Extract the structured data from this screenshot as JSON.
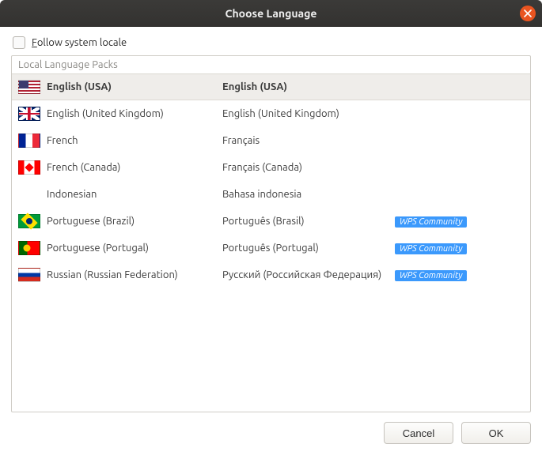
{
  "titlebar": {
    "title": "Choose Language"
  },
  "follow_checkbox": {
    "label": "Follow system locale",
    "checked": false
  },
  "list": {
    "header": "Local Language Packs",
    "items": [
      {
        "flag": "usa",
        "name": "English (USA)",
        "native": "English (USA)",
        "badge": "",
        "selected": true
      },
      {
        "flag": "uk",
        "name": "English (United Kingdom)",
        "native": "English (United Kingdom)",
        "badge": "",
        "selected": false
      },
      {
        "flag": "fr",
        "name": "French",
        "native": "Français",
        "badge": "",
        "selected": false
      },
      {
        "flag": "ca",
        "name": "French (Canada)",
        "native": "Français (Canada)",
        "badge": "",
        "selected": false
      },
      {
        "flag": "",
        "name": "Indonesian",
        "native": "Bahasa indonesia",
        "badge": "",
        "selected": false
      },
      {
        "flag": "br",
        "name": "Portuguese (Brazil)",
        "native": "Português (Brasil)",
        "badge": "WPS Community",
        "selected": false
      },
      {
        "flag": "pt",
        "name": "Portuguese (Portugal)",
        "native": "Português (Portugal)",
        "badge": "WPS Community",
        "selected": false
      },
      {
        "flag": "ru",
        "name": "Russian (Russian Federation)",
        "native": "Русский (Российская Федерация)",
        "badge": "WPS Community",
        "selected": false
      }
    ]
  },
  "buttons": {
    "cancel": "Cancel",
    "ok": "OK"
  }
}
